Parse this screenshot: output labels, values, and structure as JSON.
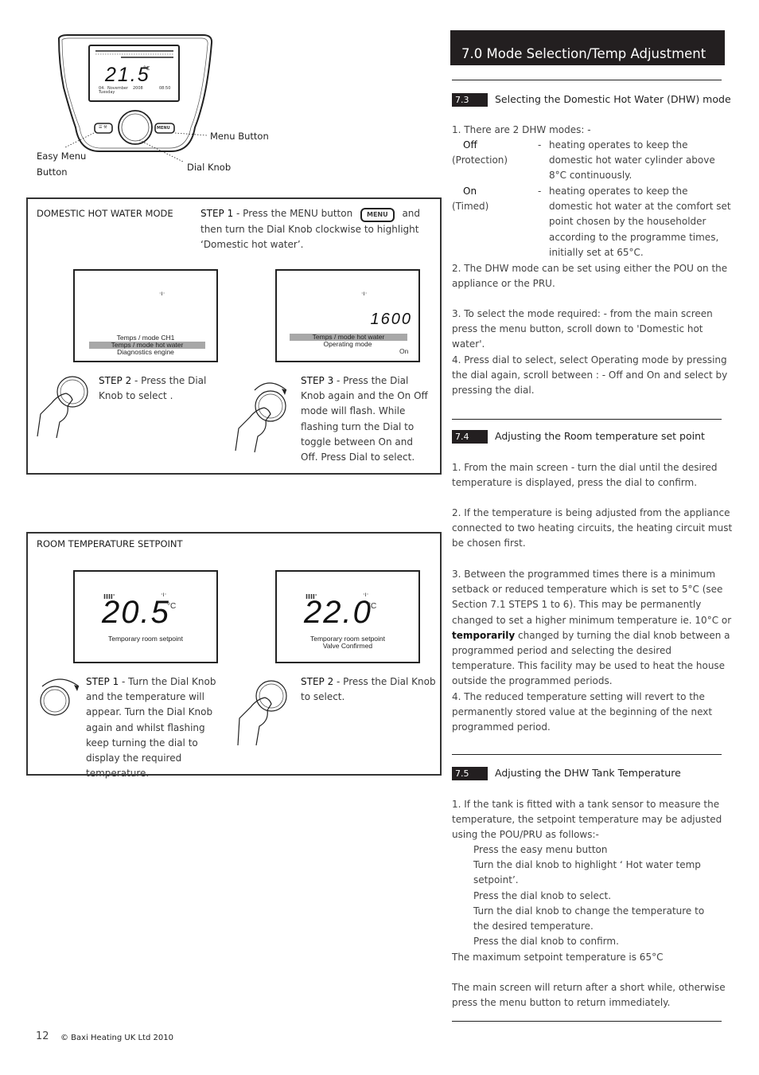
{
  "device_diagram": {
    "screen": {
      "temperature": "21.5",
      "unit": "°C",
      "date_day": "04.",
      "date_month": "November",
      "date_year": "2008",
      "time": "08:50",
      "weekday": "Tuesday"
    },
    "menu_key_label": "MENU",
    "labels": {
      "menu_button": "Menu Button",
      "easy_menu_button_line1": "Easy Menu",
      "easy_menu_button_line2": "Button",
      "dial_knob": "Dial Knob"
    }
  },
  "dhw_panel": {
    "title": "DOMESTIC HOT WATER MODE",
    "step1": {
      "label": "STEP 1",
      "text_a": " - Press the MENU button",
      "button_icon_label": "MENU",
      "text_b": "and then",
      "text_c": "turn the Dial Knob clockwise to highlight ‘Domestic hot water’."
    },
    "screen1": {
      "items": [
        "Temps / mode CH1",
        "Temps / mode hot water",
        "Diagnostics engine"
      ],
      "highlighted_index": 1
    },
    "screen2": {
      "value": "1600",
      "items": [
        "Temps / mode hot water",
        "Operating mode"
      ],
      "highlighted_index": 0,
      "flashing_value": "On"
    },
    "step2": {
      "label": "STEP  2",
      "text": " - Press the Dial Knob to select ."
    },
    "step3": {
      "label": "STEP 3",
      "text": " - Press the Dial Knob again and the On Off mode will flash. While flashing turn the Dial to toggle between On and Off. Press Dial to select."
    }
  },
  "room_panel": {
    "title": "ROOM TEMPERATURE SETPOINT",
    "screen1": {
      "value": "20.5",
      "unit": "°C",
      "caption": "Temporary room setpoint"
    },
    "screen2": {
      "value": "22.0",
      "unit": "°C",
      "caption_1": "Temporary room setpoint",
      "caption_2": "Valve Confirmed"
    },
    "step1": {
      "label": "STEP  1",
      "text": " - Turn the Dial Knob and the temperature will appear. Turn the Dial Knob again and whilst flashing keep turning the dial to display the required temperature."
    },
    "step2": {
      "label": "STEP 2",
      "text": " - Press the Dial Knob to select."
    }
  },
  "header": {
    "title": "7.0   Mode Selection/Temp Adjustment"
  },
  "section_7_3": {
    "number": "7.3",
    "title": "Selecting the Domestic Hot Water (DHW) mode",
    "intro": "1. There are 2 DHW modes: -",
    "modes": [
      {
        "name": "Off",
        "sub": "(Protection)",
        "dash": "-",
        "desc": "heating operates to keep the domestic hot water cylinder above 8°C continuously."
      },
      {
        "name": "On",
        "sub": "(Timed)",
        "dash": "-",
        "desc": "heating operates to keep the domestic hot water at the comfort set point chosen by the householder according to the programme times, initially set at 65°C."
      }
    ],
    "p2": "2. The DHW mode can be set using either the POU on the appliance or the PRU.",
    "p3": "3. To select the mode required: - from the main screen press the menu button, scroll down to 'Domestic hot water'.",
    "p4": "4. Press dial to select, select Operating mode by pressing the dial again,  scroll between : - Off and On and select by pressing the dial."
  },
  "section_7_4": {
    "number": "7.4",
    "title": "Adjusting the Room temperature set point",
    "p1": "1. From the main screen - turn the dial until the desired temperature is displayed, press the dial to confirm.",
    "p2": "2. If the temperature is being adjusted from the appliance connected to two heating circuits, the heating circuit must be chosen first.",
    "p3_a": "3. Between the programmed times there is a minimum setback or reduced temperature which is set to 5°C (see Section 7.1 STEPS 1 to 6). This may be permanently changed to set a higher minimum temperature ie. 10°C or ",
    "p3_bold": "temporarily",
    "p3_b": " changed by turning the dial knob between a programmed period and selecting the desired temperature. This facility may be used to heat the house outside the programmed periods.",
    "p4": "4. The reduced temperature setting will revert to the permanently stored value at the beginning of the next programmed period."
  },
  "section_7_5": {
    "number": "7.5",
    "title": "Adjusting the DHW  Tank Temperature",
    "p1": "1. If the tank is fitted with a tank sensor to measure the temperature, the setpoint temperature may be adjusted using the POU/PRU as follows:-",
    "steps": [
      "Press the easy menu button",
      "Turn the dial knob to highlight ‘ Hot water temp setpoint’.",
      "Press the dial knob to select.",
      "Turn the dial knob to change the temperature to the desired temperature.",
      "Press the dial knob to confirm."
    ],
    "max_note": "The maximum setpoint temperature is 65°C",
    "return_note": "The main screen will return after a short while, otherwise press the menu button to return immediately."
  },
  "footer": {
    "page_number": "12",
    "copyright": "© Baxi Heating UK Ltd 2010"
  }
}
